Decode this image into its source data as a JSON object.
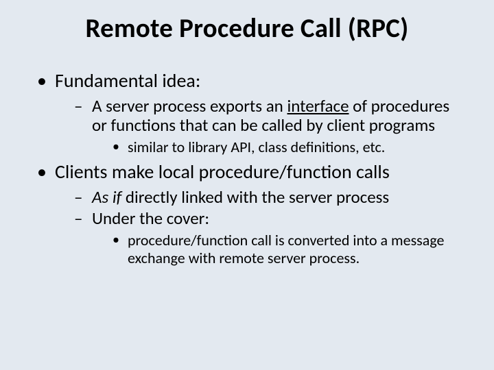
{
  "title": "Remote Procedure Call (RPC)",
  "bullets": {
    "b1": "Fundamental idea:",
    "b1_1_pre": "A server process exports an ",
    "b1_1_u": "interface",
    "b1_1_post": " of procedures or functions that can be called by client programs",
    "b1_1_1": "similar to library API, class definitions, etc.",
    "b2": "Clients make local procedure/function calls",
    "b2_1_i": "As if",
    "b2_1_post": " directly linked with the server process",
    "b2_2": "Under the cover:",
    "b2_2_1": "procedure/function call is converted into a message exchange with remote server process."
  }
}
